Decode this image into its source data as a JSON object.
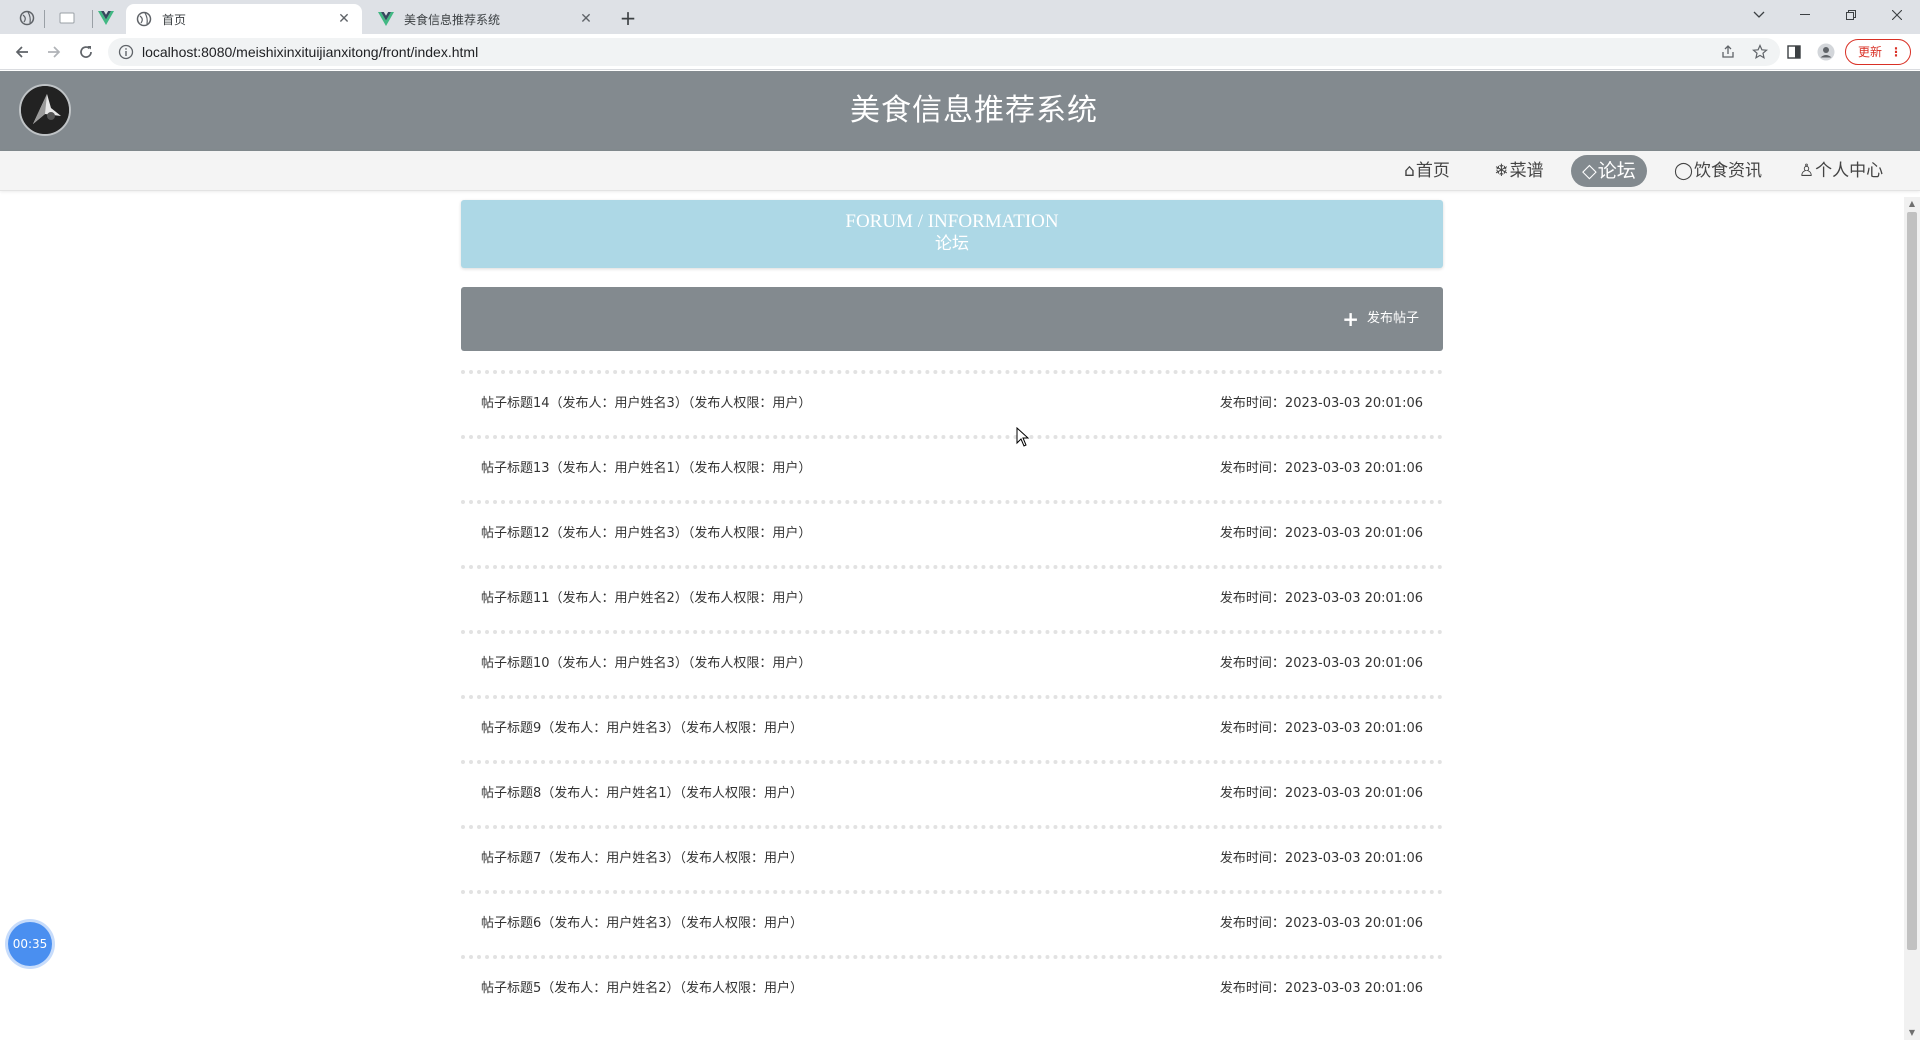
{
  "browser": {
    "tabs": [
      {
        "title": "首页",
        "active": true
      },
      {
        "title": "美食信息推荐系统",
        "active": false
      }
    ],
    "url": "localhost:8080/meishixinxituijianxitong/front/index.html",
    "update_label": "更新",
    "update_dots": "⋮"
  },
  "site": {
    "title": "美食信息推荐系统"
  },
  "nav": {
    "items": [
      {
        "icon": "⌂",
        "label": "首页"
      },
      {
        "icon": "❄",
        "label": "菜谱"
      },
      {
        "icon": "◇",
        "label": "论坛"
      },
      {
        "icon": "◯",
        "label": "饮食资讯"
      },
      {
        "icon": "♙",
        "label": "个人中心"
      }
    ],
    "active_index": 2
  },
  "banner": {
    "en": "FORUM / INFORMATION",
    "zh": "论坛"
  },
  "actions": {
    "publish_label": "发布帖子"
  },
  "posts": [
    {
      "title": "帖子标题14（发布人：用户姓名3）（发布人权限：用户）",
      "time": "发布时间：2023-03-03 20:01:06"
    },
    {
      "title": "帖子标题13（发布人：用户姓名1）（发布人权限：用户）",
      "time": "发布时间：2023-03-03 20:01:06"
    },
    {
      "title": "帖子标题12（发布人：用户姓名3）（发布人权限：用户）",
      "time": "发布时间：2023-03-03 20:01:06"
    },
    {
      "title": "帖子标题11（发布人：用户姓名2）（发布人权限：用户）",
      "time": "发布时间：2023-03-03 20:01:06"
    },
    {
      "title": "帖子标题10（发布人：用户姓名3）（发布人权限：用户）",
      "time": "发布时间：2023-03-03 20:01:06"
    },
    {
      "title": "帖子标题9（发布人：用户姓名3）（发布人权限：用户）",
      "time": "发布时间：2023-03-03 20:01:06"
    },
    {
      "title": "帖子标题8（发布人：用户姓名1）（发布人权限：用户）",
      "time": "发布时间：2023-03-03 20:01:06"
    },
    {
      "title": "帖子标题7（发布人：用户姓名3）（发布人权限：用户）",
      "time": "发布时间：2023-03-03 20:01:06"
    },
    {
      "title": "帖子标题6（发布人：用户姓名3）（发布人权限：用户）",
      "time": "发布时间：2023-03-03 20:01:06"
    },
    {
      "title": "帖子标题5（发布人：用户姓名2）（发布人权限：用户）",
      "time": "发布时间：2023-03-03 20:01:06"
    }
  ],
  "overlay": {
    "timer": "00:35"
  },
  "colors": {
    "header_bg": "#838a8f",
    "banner_bg": "#add8e6",
    "nav_bg": "#f4f4f4"
  }
}
